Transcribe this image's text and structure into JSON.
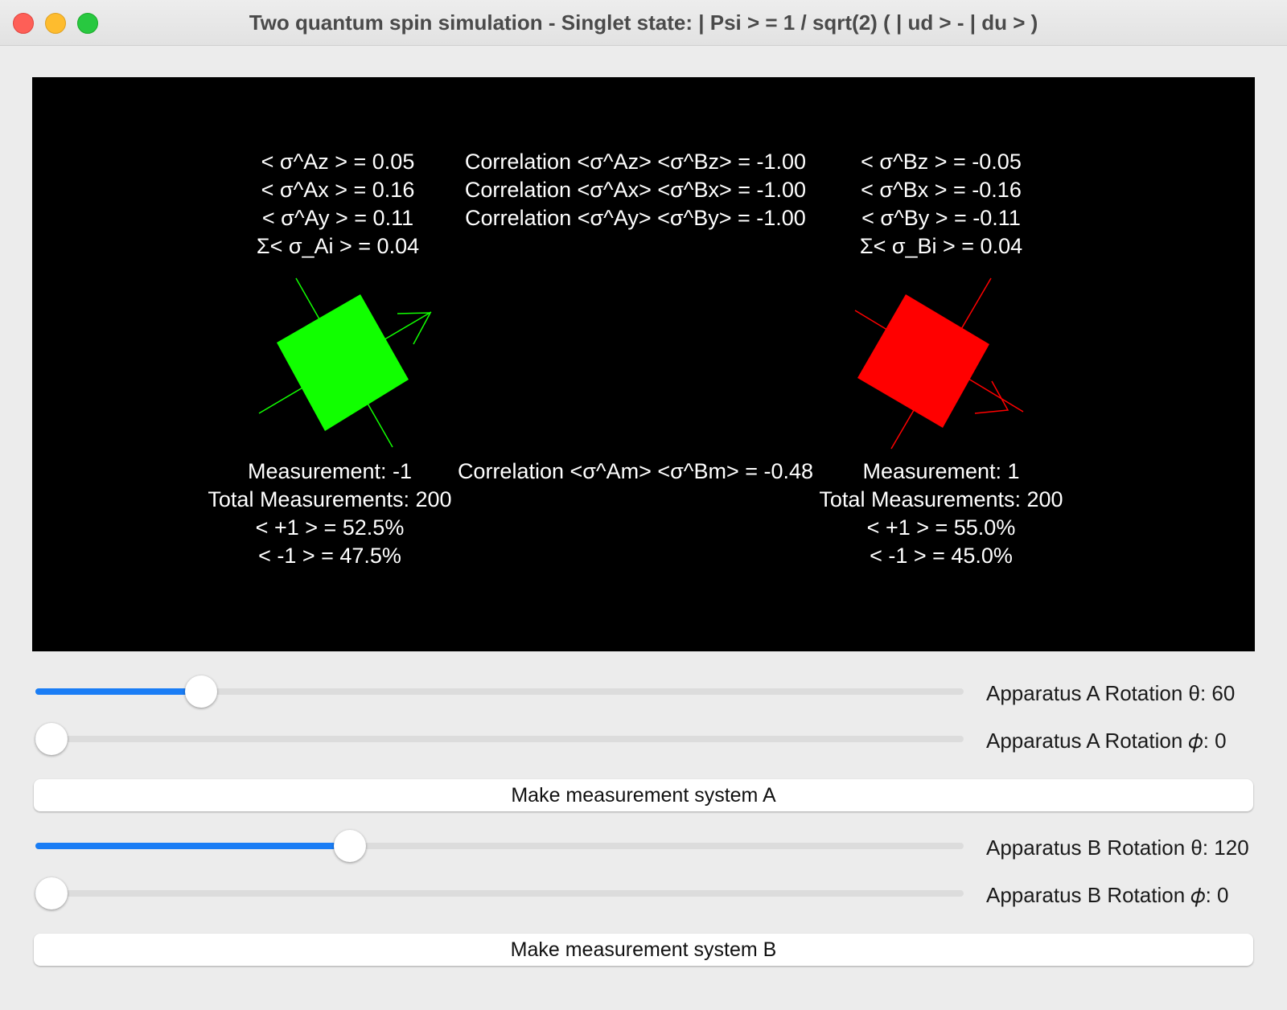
{
  "window": {
    "title": "Two quantum spin simulation - Singlet state: | Psi > = 1 / sqrt(2) ( | ud > - | du > )"
  },
  "system_a": {
    "expectations": [
      "< σ^Az > = 0.05",
      "< σ^Ax > = 0.16",
      "< σ^Ay > = 0.11",
      "Σ< σ_Ai > = 0.04"
    ],
    "measurement": [
      "Measurement: -1",
      "Total Measurements: 200",
      "< +1 > = 52.5%",
      "< -1 > = 47.5%"
    ],
    "color": "#11ff00"
  },
  "system_b": {
    "expectations": [
      "< σ^Bz > = -0.05",
      "< σ^Bx > = -0.16",
      "< σ^By > = -0.11",
      "Σ< σ_Bi > = 0.04"
    ],
    "measurement": [
      "Measurement: 1",
      "Total Measurements: 200",
      "< +1 > = 55.0%",
      "< -1 > = 45.0%"
    ],
    "color": "#ff0000"
  },
  "correlations": [
    "Correlation <σ^Az> <σ^Bz> = -1.00",
    "Correlation <σ^Ax> <σ^Bx> = -1.00",
    "Correlation <σ^Ay> <σ^By> = -1.00"
  ],
  "correlation_measurement": "Correlation <σ^Am> <σ^Bm> = -0.48",
  "controls": {
    "a_theta": {
      "label": "Apparatus A Rotation θ: 60",
      "value": 60,
      "max": 360
    },
    "a_phi": {
      "label": "Apparatus A Rotation 𝜙: 0",
      "value": 0,
      "max": 360
    },
    "measure_a": "Make measurement system A",
    "b_theta": {
      "label": "Apparatus B Rotation θ: 120",
      "value": 120,
      "max": 360
    },
    "b_phi": {
      "label": "Apparatus B Rotation 𝜙: 0",
      "value": 0,
      "max": 360
    },
    "measure_b": "Make measurement system B"
  },
  "accent_color": "#1a7df5"
}
